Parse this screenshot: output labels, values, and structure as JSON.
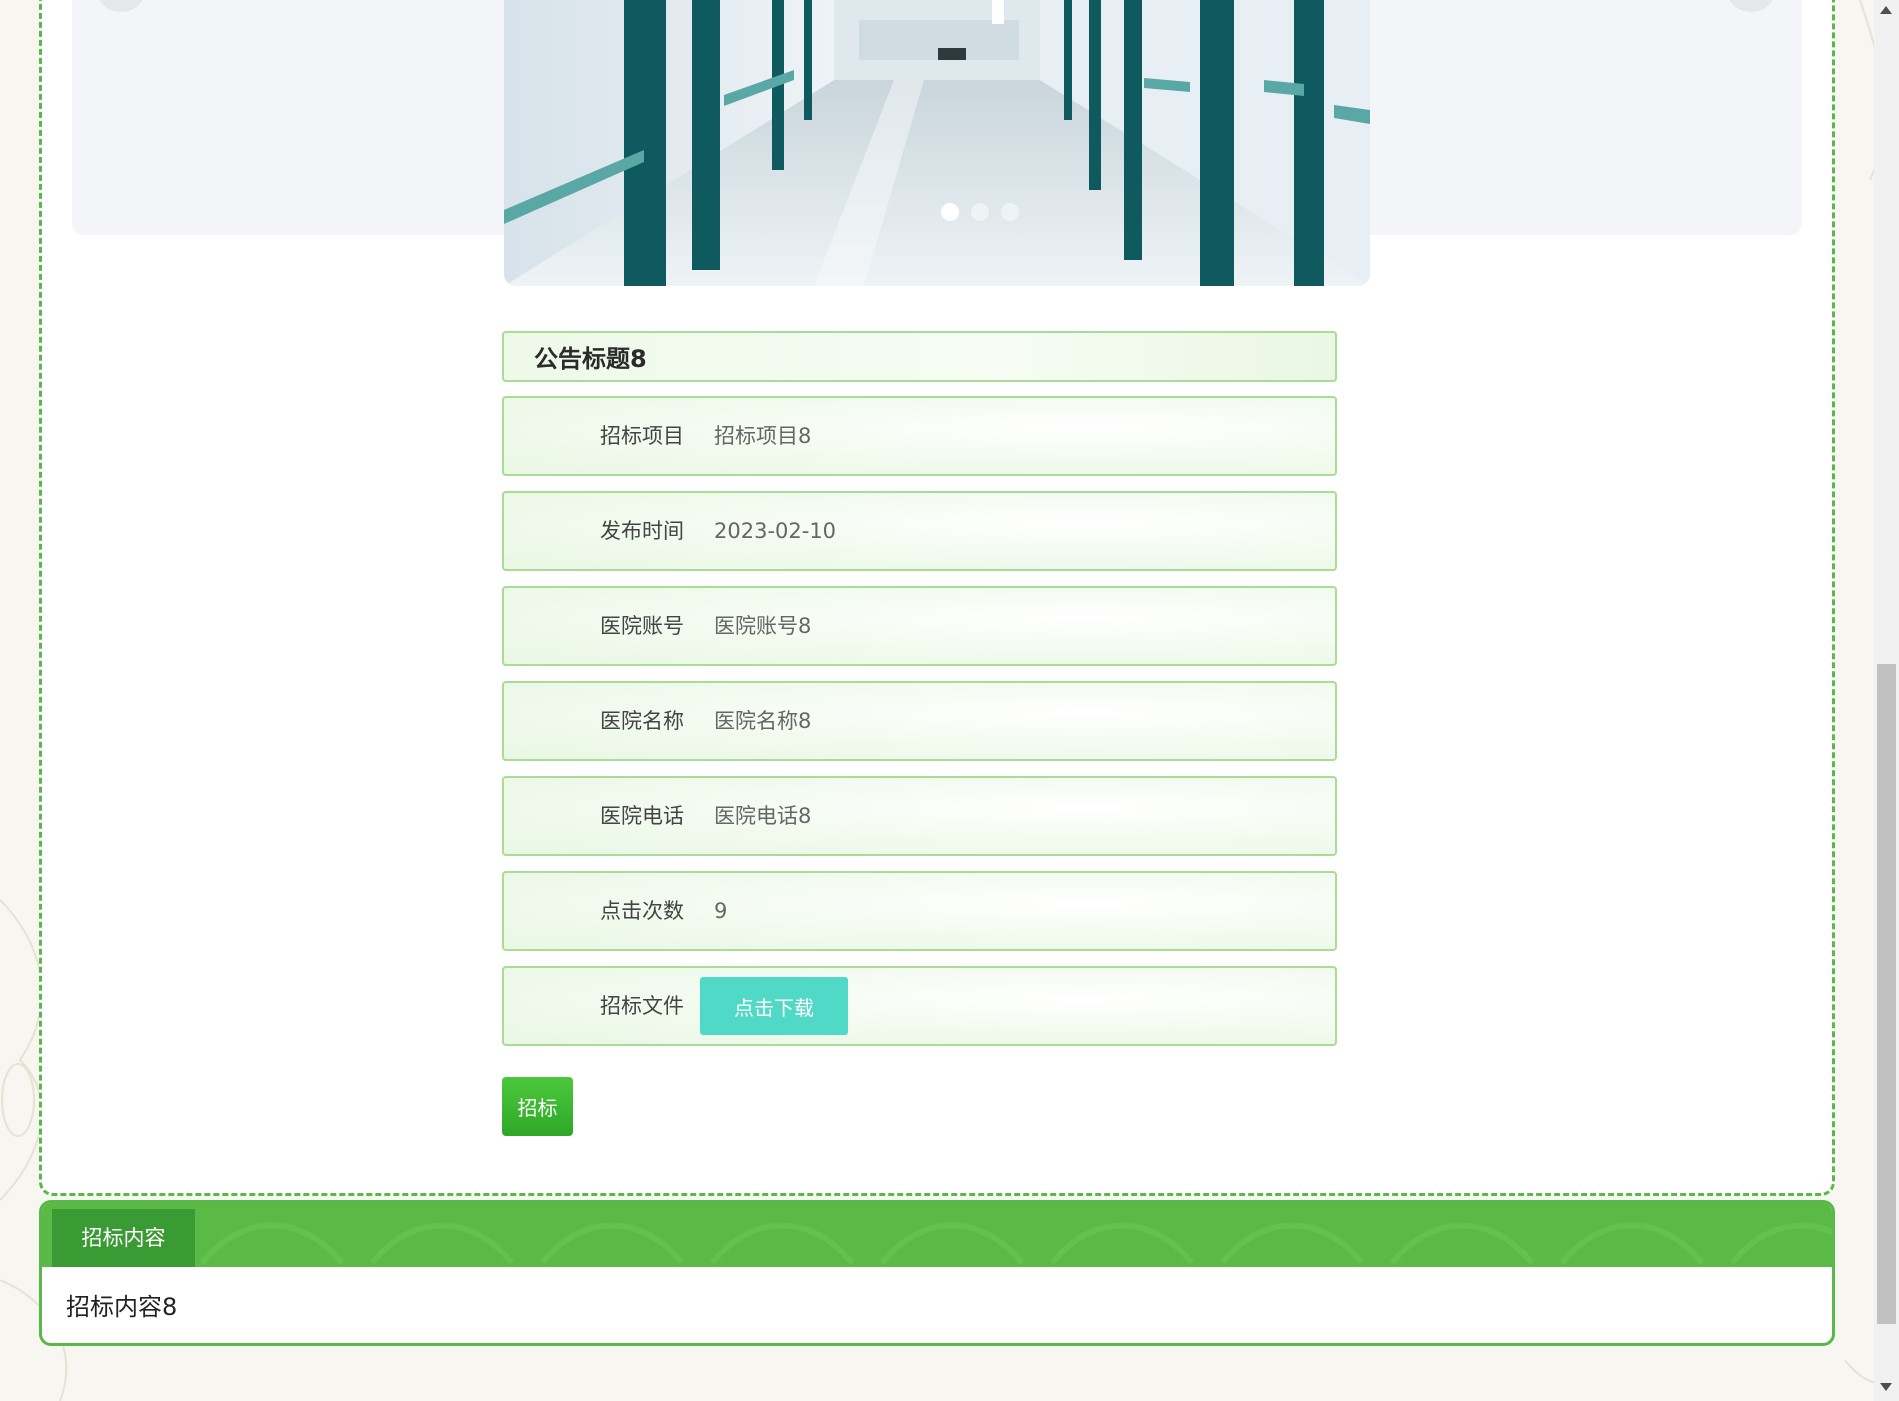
{
  "hero": {
    "active_slide": 1,
    "slide_count": 3
  },
  "notice": {
    "title": "公告标题8"
  },
  "fields": [
    {
      "label": "招标项目",
      "value": "招标项目8"
    },
    {
      "label": "发布时间",
      "value": "2023-02-10"
    },
    {
      "label": "医院账号",
      "value": "医院账号8"
    },
    {
      "label": "医院名称",
      "value": "医院名称8"
    },
    {
      "label": "医院电话",
      "value": "医院电话8"
    },
    {
      "label": "点击次数",
      "value": "9"
    },
    {
      "label": "招标文件",
      "button": "点击下载"
    }
  ],
  "actions": {
    "bid_label": "招标"
  },
  "content_section": {
    "tab_label": "招标内容",
    "body": "招标内容8"
  },
  "colors": {
    "accent": "#5aba45",
    "download": "#4fd9c6",
    "border": "#a9dd95"
  }
}
